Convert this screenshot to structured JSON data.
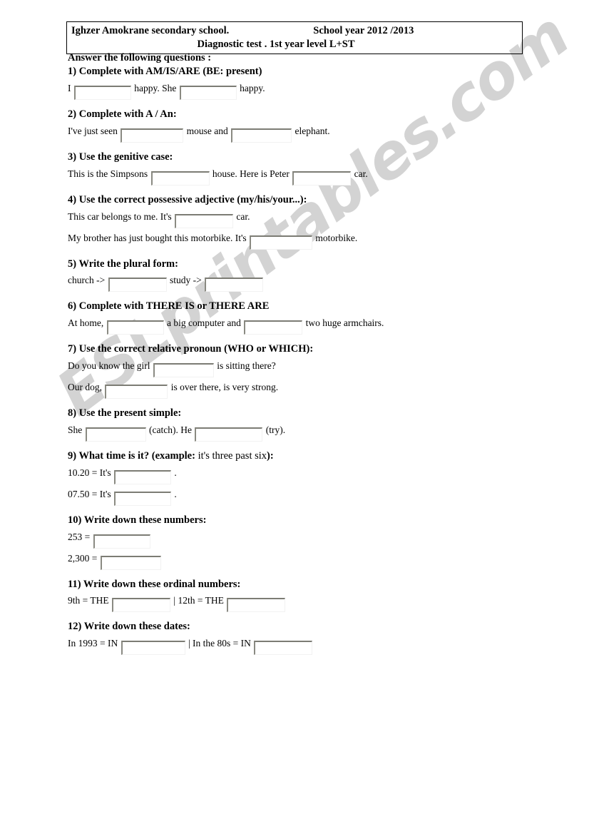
{
  "header": {
    "school": "Ighzer Amokrane secondary school.",
    "school_year": "School year 2012 /2013",
    "test_line": "Diagnostic test . 1st year level L+ST"
  },
  "intro": "Answer the following questions :",
  "watermark": "ESLprintables.com",
  "colors": {
    "text": "#000000",
    "header_border": "#000000",
    "blank_border_dark": "#7c7c74",
    "watermark": "#d3d3d3"
  },
  "questions": [
    {
      "number": "1)",
      "title": "Complete with AM/IS/ARE (BE: present)",
      "title_plain": "",
      "lines": [
        {
          "segments": [
            "I",
            "BLANK",
            "happy. She",
            "BLANK",
            "happy."
          ]
        }
      ]
    },
    {
      "number": "2)",
      "title": "Complete with A / An:",
      "title_plain": "",
      "lines": [
        {
          "segments": [
            "I've just seen",
            "BLANK",
            "mouse and",
            "BLANK",
            "elephant."
          ]
        }
      ]
    },
    {
      "number": "3)",
      "title": "Use the genitive case:",
      "title_plain": "",
      "lines": [
        {
          "segments": [
            "This is the Simpsons",
            "BLANK",
            "house. Here is Peter",
            "BLANK",
            "car."
          ]
        }
      ]
    },
    {
      "number": "4)",
      "title": "Use the correct possessive adjective (my/his/your...):",
      "title_plain": "",
      "lines": [
        {
          "segments": [
            "This car belongs to me. It's",
            "BLANK",
            "car."
          ]
        },
        {
          "segments": [
            "My brother has just bought this motorbike. It's",
            "BLANK",
            "motorbike."
          ]
        }
      ]
    },
    {
      "number": "5)",
      "title": "Write the plural form:",
      "title_plain": "",
      "lines": [
        {
          "segments": [
            "church ->",
            "BLANK",
            "study ->",
            "BLANK",
            ""
          ]
        }
      ]
    },
    {
      "number": "6)",
      "title": "Complete with THERE IS or THERE ARE",
      "title_plain": "",
      "lines": [
        {
          "segments": [
            "At home,",
            "BLANK",
            "a big computer and",
            "BLANK",
            "two huge armchairs."
          ]
        }
      ]
    },
    {
      "number": "7)",
      "title": "Use the correct relative pronoun (WHO or WHICH):",
      "title_plain": "",
      "lines": [
        {
          "segments": [
            "Do you know the girl",
            "BLANK",
            "is sitting there?"
          ]
        },
        {
          "segments": [
            "Our dog,",
            "BLANK",
            "is over there, is very strong."
          ]
        }
      ]
    },
    {
      "number": "8)",
      "title": "Use the present simple:",
      "title_plain": "",
      "lines": [
        {
          "segments": [
            "She",
            "BLANK",
            "(catch). He",
            "BLANK",
            "(try)."
          ]
        }
      ]
    },
    {
      "number": "9)",
      "title": "What time is it? (example:",
      "title_plain": "it's three past six",
      "title_tail": "):",
      "lines": [
        {
          "segments": [
            "10.20 = It's",
            "BLANK",
            "."
          ]
        },
        {
          "segments": [
            "07.50 = It's",
            "BLANK",
            "."
          ]
        }
      ]
    },
    {
      "number": "10)",
      "title": "Write down these numbers:",
      "title_plain": "",
      "lines": [
        {
          "segments": [
            "253 =",
            "BLANK",
            ""
          ]
        },
        {
          "segments": [
            "2,300 =",
            "BLANK",
            ""
          ]
        }
      ]
    },
    {
      "number": "11)",
      "title": "Write down these ordinal numbers:",
      "title_plain": "",
      "lines": [
        {
          "segments": [
            "9th = THE",
            "BLANK",
            "| 12th = THE",
            "BLANK",
            ""
          ]
        }
      ]
    },
    {
      "number": "12)",
      "title": "Write down these dates:",
      "title_plain": "",
      "lines": [
        {
          "segments": [
            "In 1993 = IN",
            "BLANK",
            "| In the 80s = IN",
            "BLANK",
            ""
          ]
        }
      ]
    }
  ]
}
